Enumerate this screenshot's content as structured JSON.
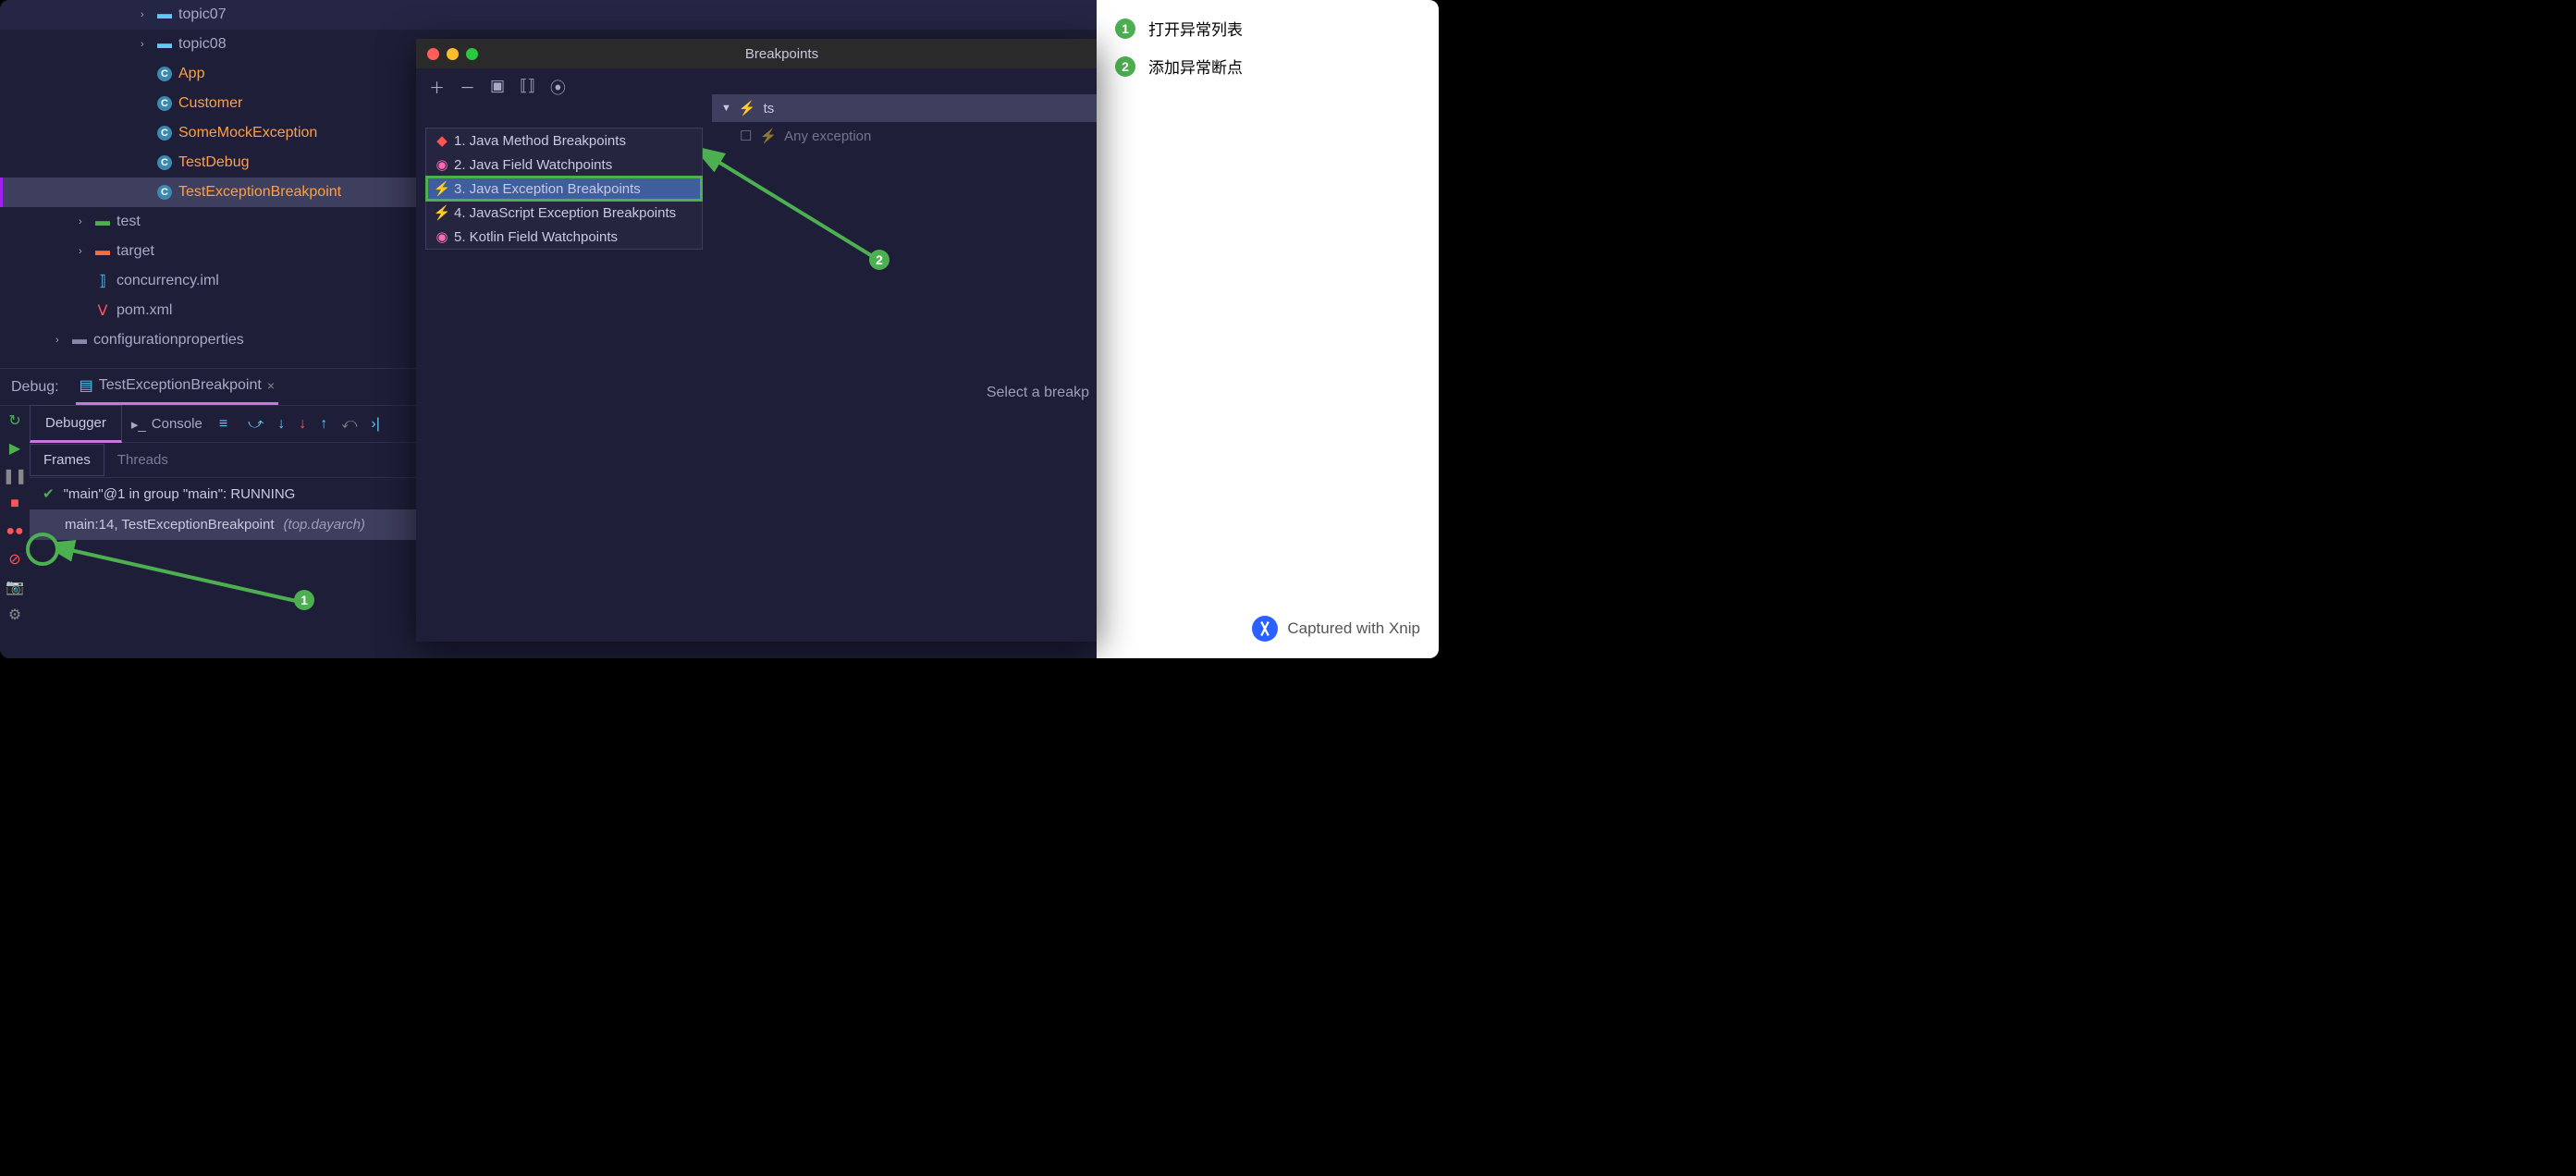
{
  "tree": {
    "topic07": "topic07",
    "topic08": "topic08",
    "app": "App",
    "customer": "Customer",
    "someMockException": "SomeMockException",
    "testDebug": "TestDebug",
    "testExceptionBreakpoint": "TestExceptionBreakpoint",
    "test": "test",
    "target": "target",
    "concurrencyIml": "concurrency.iml",
    "pomXml": "pom.xml",
    "configProps": "configurationproperties"
  },
  "debug": {
    "label": "Debug:",
    "configName": "TestExceptionBreakpoint",
    "tabDebugger": "Debugger",
    "tabConsole": "Console",
    "tabFrames": "Frames",
    "tabThreads": "Threads",
    "threadStatus": "\"main\"@1 in group \"main\": RUNNING",
    "frameLine": "main:14, TestExceptionBreakpoint",
    "framePkg": "(top.dayarch)"
  },
  "dialog": {
    "title": "Breakpoints",
    "menu": {
      "1": "1. Java Method Breakpoints",
      "2": "2. Java Field Watchpoints",
      "3": "3. Java Exception Breakpoints",
      "4": "4. JavaScript Exception Breakpoints",
      "5": "5. Kotlin Field Watchpoints"
    },
    "tsCat": "ts",
    "anyException": "Any exception",
    "hint": "Select a breakp"
  },
  "annotations": {
    "1": "打开异常列表",
    "2": "添加异常断点"
  },
  "capture": "Captured with Xnip"
}
